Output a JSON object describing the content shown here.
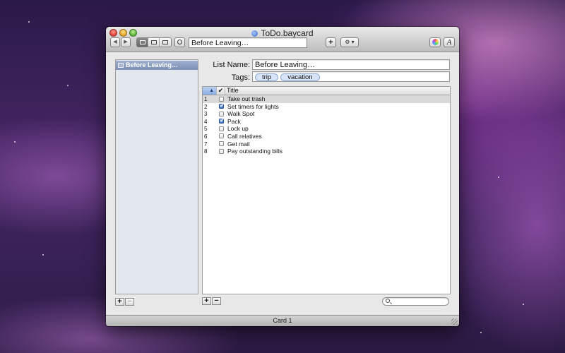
{
  "window": {
    "title": "ToDo.baycard"
  },
  "toolbar": {
    "back_glyph": "◀",
    "forward_glyph": "▶",
    "search_field_value": "Before Leaving…",
    "add_label": "+",
    "action_label": "⚙ ▾",
    "font_label": "A"
  },
  "sidebar": {
    "items": [
      {
        "label": "Before Leaving…"
      }
    ],
    "add_label": "+",
    "remove_label": "−"
  },
  "form": {
    "list_name_label": "List Name:",
    "list_name_value": "Before Leaving…",
    "tags_label": "Tags:",
    "tags": [
      "trip",
      "vacation"
    ]
  },
  "table": {
    "sort_glyph": "▲",
    "check_header": "✔",
    "title_header": "Title",
    "rows": [
      {
        "num": "1",
        "checked": false,
        "title": "Take out trash"
      },
      {
        "num": "2",
        "checked": true,
        "title": "Set timers for lights"
      },
      {
        "num": "3",
        "checked": false,
        "title": "Walk Spot"
      },
      {
        "num": "4",
        "checked": true,
        "title": "Pack"
      },
      {
        "num": "5",
        "checked": false,
        "title": "Lock up"
      },
      {
        "num": "6",
        "checked": false,
        "title": "Call relatives"
      },
      {
        "num": "7",
        "checked": false,
        "title": "Get mail"
      },
      {
        "num": "8",
        "checked": false,
        "title": "Pay outstanding bills"
      }
    ],
    "add_label": "+",
    "remove_label": "−",
    "search_value": ""
  },
  "status": {
    "label": "Card 1"
  }
}
